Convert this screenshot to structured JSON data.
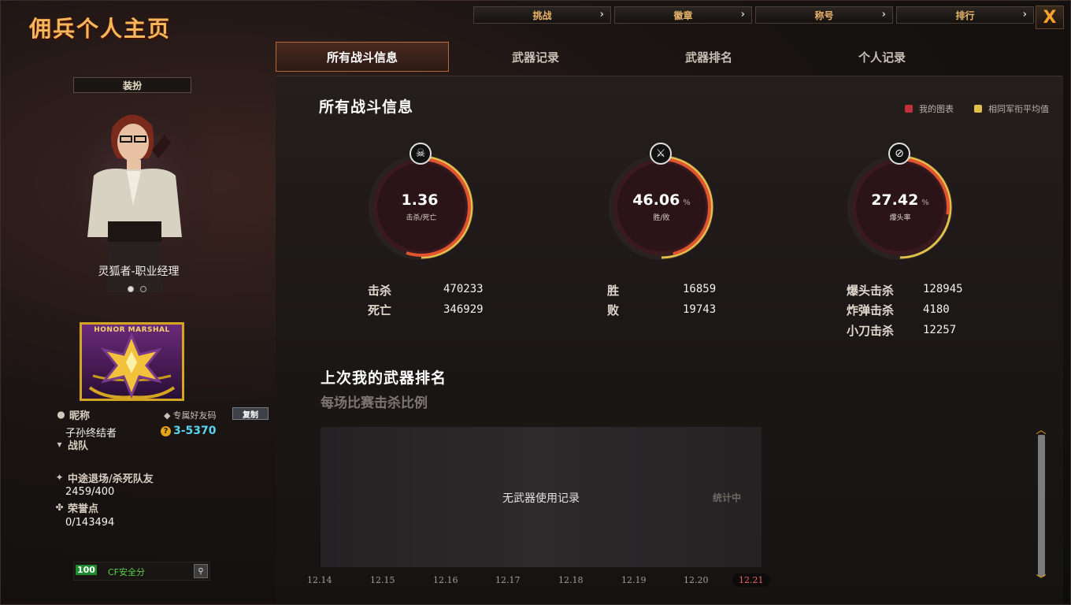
{
  "app": {
    "title": "佣兵个人主页"
  },
  "top_nav": [
    {
      "label": "挑战"
    },
    {
      "label": "徽章"
    },
    {
      "label": "称号"
    },
    {
      "label": "排行"
    }
  ],
  "close_label": "X",
  "tabs": [
    {
      "label": "所有战斗信息",
      "active": true
    },
    {
      "label": "武器记录"
    },
    {
      "label": "武器排名"
    },
    {
      "label": "个人记录"
    }
  ],
  "left": {
    "outfit_button": "装扮",
    "character_name": "灵狐者-职业经理",
    "rank_badge_text": "HONOR MARSHAL",
    "nickname_label": "昵称",
    "nickname": "子孙终结者",
    "friend_code_label": "专属好友码",
    "copy_button": "复制",
    "friend_code": "3-5370",
    "team_label": "战队",
    "quit_label": "中途退场/杀死队友",
    "quit_value": "2459/400",
    "honor_label": "荣誉点",
    "honor_value": "0/143494",
    "safety_score": "100",
    "safety_label": "CF安全分"
  },
  "content": {
    "title": "所有战斗信息",
    "legend": [
      {
        "label": "我的图表",
        "color": "#c0303a"
      },
      {
        "label": "相同军衔平均值",
        "color": "#e0c04a"
      }
    ],
    "gauges": [
      {
        "value": "1.36",
        "unit": "",
        "label": "击杀/死亡",
        "icon": "skull-icon",
        "fill": 0.55
      },
      {
        "value": "46.06",
        "unit": "%",
        "label": "胜/败",
        "icon": "crossed-guns-icon",
        "fill": 0.4606
      },
      {
        "value": "27.42",
        "unit": "%",
        "label": "爆头率",
        "icon": "no-rifle-icon",
        "fill": 0.2742
      }
    ],
    "stats": {
      "kills_label": "击杀",
      "kills": "470233",
      "deaths_label": "死亡",
      "deaths": "346929",
      "wins_label": "胜",
      "wins": "16859",
      "losses_label": "败",
      "losses": "19743",
      "headshot_label": "爆头击杀",
      "headshot": "128945",
      "bomb_label": "炸弹击杀",
      "bomb": "4180",
      "knife_label": "小刀击杀",
      "knife": "12257"
    },
    "weapon_title": "上次我的武器排名",
    "weapon_subtitle": "每场比赛击杀比例",
    "chart_empty": "无武器使用记录",
    "chart_side": "统计中",
    "dates": [
      "12.14",
      "12.15",
      "12.16",
      "12.17",
      "12.18",
      "12.19",
      "12.20",
      "12.21"
    ],
    "selected_date": "12.21"
  }
}
